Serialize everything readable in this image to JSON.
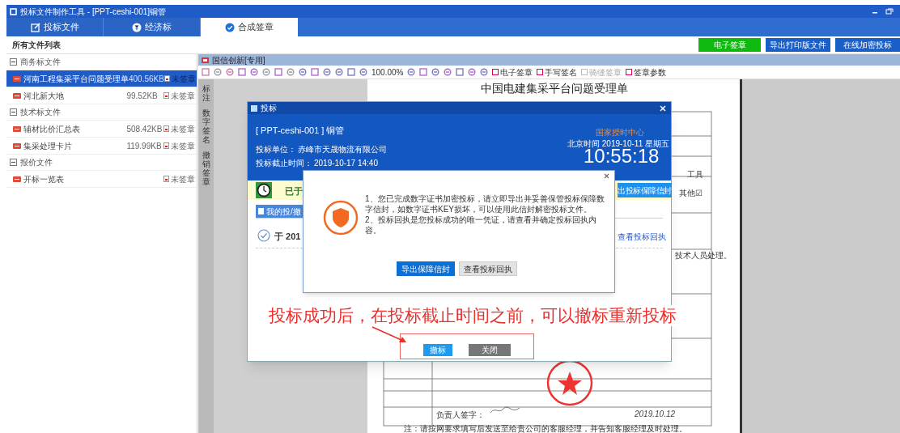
{
  "window": {
    "title": "投标文件制作工具 - [PPT-ceshi-001]铜管"
  },
  "tabs": [
    {
      "label": "投标文件",
      "selected": false
    },
    {
      "label": "经济标",
      "selected": false
    },
    {
      "label": "合成签章",
      "selected": true
    }
  ],
  "file_list": {
    "title": "所有文件列表",
    "groups": [
      {
        "label": "商务标文件",
        "expanded": true,
        "children": [
          {
            "name": "河南工程集采平台问题受理单",
            "size": "400.56KB",
            "status": "未签章",
            "selected": true
          },
          {
            "name": "河北新大地",
            "size": "99.52KB",
            "status": "未签章",
            "selected": false
          }
        ]
      },
      {
        "label": "技术标文件",
        "expanded": true,
        "children": [
          {
            "name": "辅材比价汇总表",
            "size": "508.42KB",
            "status": "未签章",
            "selected": false
          },
          {
            "name": "集采处理卡片",
            "size": "119.99KB",
            "status": "未签章",
            "selected": false
          }
        ]
      },
      {
        "label": "报价文件",
        "expanded": true,
        "children": [
          {
            "name": "开标一览表",
            "status": "未签章",
            "selected": false
          }
        ]
      }
    ]
  },
  "actions": [
    {
      "label": "电子签章",
      "kind": "sign"
    },
    {
      "label": "导出打印版文件",
      "kind": "export"
    },
    {
      "label": "在线加密投标",
      "kind": "export"
    }
  ],
  "viewer": {
    "title": "国信创新[专用]",
    "zoom": "100.00%",
    "tools": [
      {
        "label": "电子签章",
        "disabled": false
      },
      {
        "label": "手写签名",
        "disabled": false
      },
      {
        "label": "骑缝签章",
        "disabled": true
      },
      {
        "label": "签章参数",
        "disabled": false
      }
    ],
    "side_tabs": [
      "标注",
      "数字签名",
      "撤销签章"
    ]
  },
  "document": {
    "title": "中国电建集采平台问题受理单",
    "cells": [
      "工具",
      "其他☑",
      "技术人员处理。"
    ],
    "signer": "负责人签字：",
    "date": "2019.10.12",
    "note": "注：请按网要求填写后发送至给贵公司的客服经理，并告知客服经理及时处理。"
  },
  "bid_dialog": {
    "title": "投标",
    "project": "[ PPT-ceshi-001 ] 铜管",
    "bidder_label": "投标单位：",
    "bidder": "赤峰市天晟物流有限公司",
    "deadline_label": "投标截止时间：",
    "deadline": "2019-10-17 14:40",
    "time_source": "国家授时中心",
    "date": "北京时间 2019-10-11 星期五",
    "clock": "10:55:18",
    "status": "已于",
    "export_button": "出投标保障信封",
    "tab": "我的投/撤",
    "record": "于 201",
    "receipt_link": "查看投标回执",
    "buttons": [
      {
        "label": "撤标",
        "kind": "primary"
      },
      {
        "label": "关闭",
        "kind": "secondary"
      }
    ]
  },
  "alert": {
    "lines": [
      "1、您已完成数字证书加密投标，请立即导出并妥善保管投标保障数字信封，如数字证书KEY损坏，可以使用此信封解密投标文件。",
      "2、投标回执是您投标成功的唯一凭证，请查看并确定投标回执内容。"
    ],
    "buttons": [
      {
        "label": "导出保障信封",
        "kind": "primary"
      },
      {
        "label": "查看投标回执",
        "kind": "secondary"
      }
    ]
  },
  "annotation": {
    "text": "投标成功后，在投标截止时间之前，可以撤标重新投标"
  }
}
